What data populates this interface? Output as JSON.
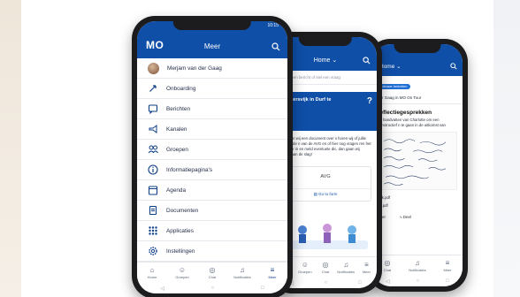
{
  "phone1": {
    "logo": "MO",
    "title": "Meer",
    "status_time": "10:15",
    "menu": [
      {
        "label": "Merjam van der Gaag",
        "icon": "avatar"
      },
      {
        "label": "Onboarding",
        "icon": "rocket-icon"
      },
      {
        "label": "Berichten",
        "icon": "message-icon"
      },
      {
        "label": "Kanalen",
        "icon": "megaphone-icon"
      },
      {
        "label": "Groepen",
        "icon": "group-icon"
      },
      {
        "label": "Informatiepagina's",
        "icon": "info-icon"
      },
      {
        "label": "Agenda",
        "icon": "calendar-icon"
      },
      {
        "label": "Documenten",
        "icon": "document-icon"
      },
      {
        "label": "Applicaties",
        "icon": "grid-icon"
      },
      {
        "label": "Instellingen",
        "icon": "gear-icon"
      }
    ],
    "tabs": [
      {
        "label": "Home",
        "icon": "home-icon"
      },
      {
        "label": "Groepen",
        "icon": "group-icon"
      },
      {
        "label": "Chat",
        "icon": "chat-icon"
      },
      {
        "label": "Notificaties",
        "icon": "bell-icon"
      },
      {
        "label": "Meer",
        "icon": "menu-icon"
      }
    ]
  },
  "phone2": {
    "title": "Home ⌄",
    "placeholder": "Schrijf een bericht of stel een vraag",
    "banner_title": "e Blittersvijk in Durf te",
    "banner_sub": "ron",
    "body": "plaatsten wij een document over s horen wij of jullie voldoende n van de AVG en of hier nog vragen ren het formulier in en meld eventuele dic, dan gaan wij ermee aan de slag!",
    "card_title": "AVG",
    "card_link": "Go to form",
    "tabs": [
      "Home",
      "Groepen",
      "Chat",
      "Notificaties",
      "Meer"
    ]
  },
  "phone3": {
    "title": "Home ⌄",
    "pill": "Nieuwe berichten",
    "group": "der Gaag in MO On Tour",
    "heading": "reflectiegesprekken",
    "text": "en handvatten van Charlotte om een constructief n te gaan in de uitkomst van",
    "files": [
      "pok.pdf",
      "ek.pdf"
    ],
    "actions": [
      "ager",
      "Deel"
    ],
    "tabs": [
      "Chat",
      "Notificaties",
      "Meer"
    ]
  },
  "colors": {
    "brand": "#0f4fa8"
  }
}
